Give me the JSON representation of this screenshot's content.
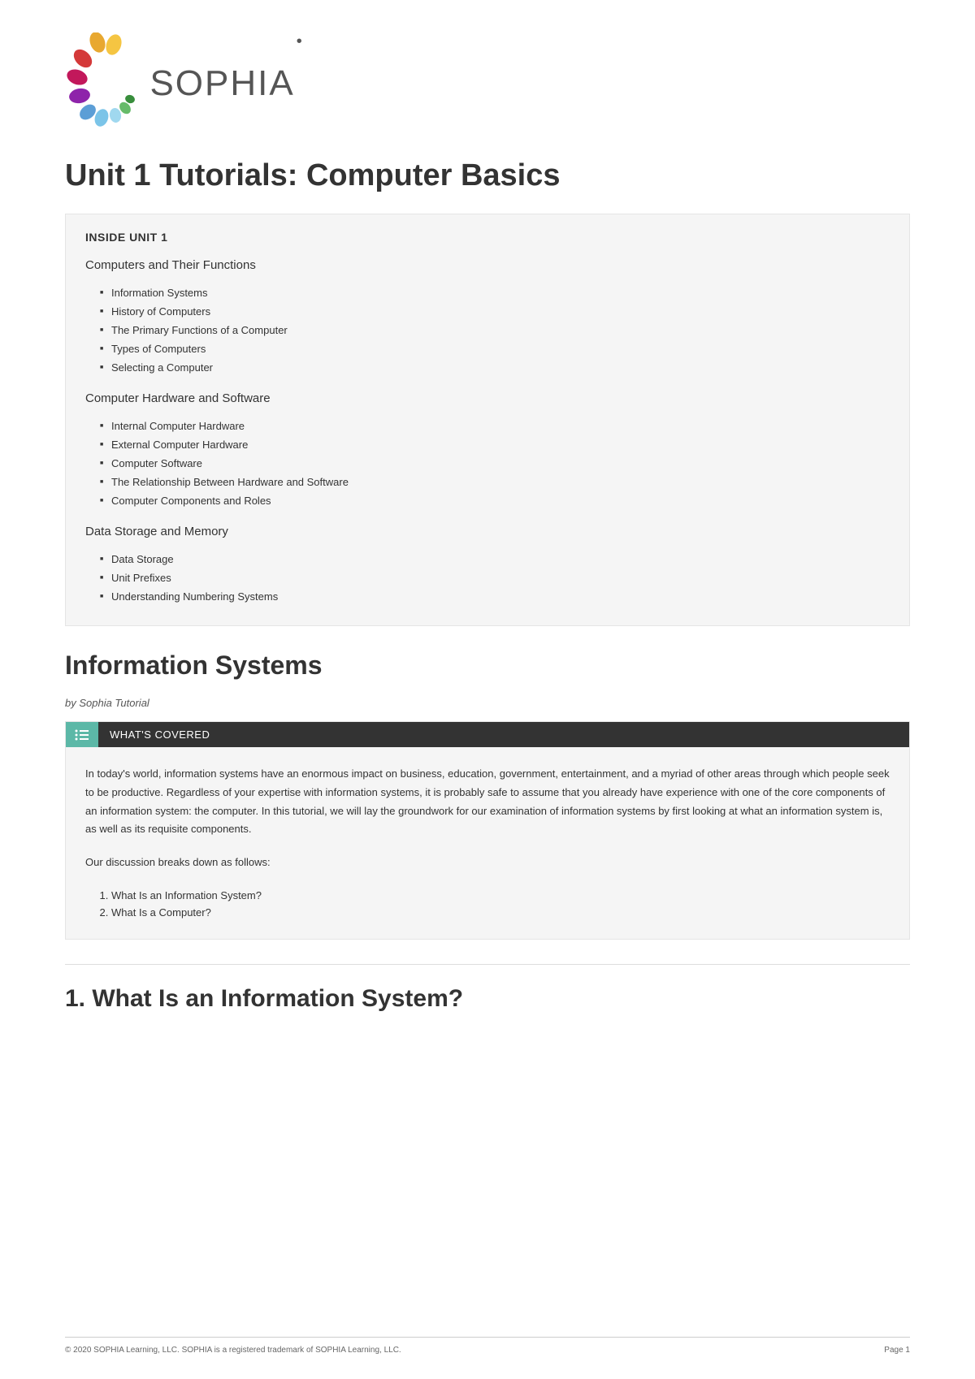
{
  "logo": {
    "text": "SOPHIA"
  },
  "title": "Unit 1 Tutorials: Computer Basics",
  "inside": {
    "heading": "INSIDE UNIT 1",
    "sections": [
      {
        "title": "Computers and Their Functions",
        "items": [
          "Information Systems",
          "History of Computers",
          "The Primary Functions of a Computer",
          "Types of Computers",
          "Selecting a Computer"
        ]
      },
      {
        "title": "Computer Hardware and Software",
        "items": [
          "Internal Computer Hardware",
          "External Computer Hardware",
          "Computer Software",
          "The Relationship Between Hardware and Software",
          "Computer Components and Roles"
        ]
      },
      {
        "title": "Data Storage and Memory",
        "items": [
          "Data Storage",
          "Unit Prefixes",
          "Understanding Numbering Systems"
        ]
      }
    ]
  },
  "article": {
    "heading": "Information Systems",
    "byline": "by Sophia Tutorial",
    "covered": {
      "label": "WHAT'S COVERED",
      "intro": "In today's world, information systems have an enormous impact on business, education, government, entertainment, and a myriad of other areas through which people seek to be productive. Regardless of your expertise with information systems, it is probably safe to assume that you already have experience with one of the core components of an information system: the computer. In this tutorial, we will lay the groundwork for our examination of information systems by first looking at what an information system is, as well as its requisite components.",
      "breakdown": "Our discussion breaks down as follows:",
      "items": [
        "What Is an Information System?",
        "What Is a Computer?"
      ]
    },
    "section1_heading": "1. What Is an Information System?"
  },
  "footer": {
    "copyright": "© 2020 SOPHIA Learning, LLC. SOPHIA is a registered trademark of SOPHIA Learning, LLC.",
    "page": "Page 1"
  }
}
